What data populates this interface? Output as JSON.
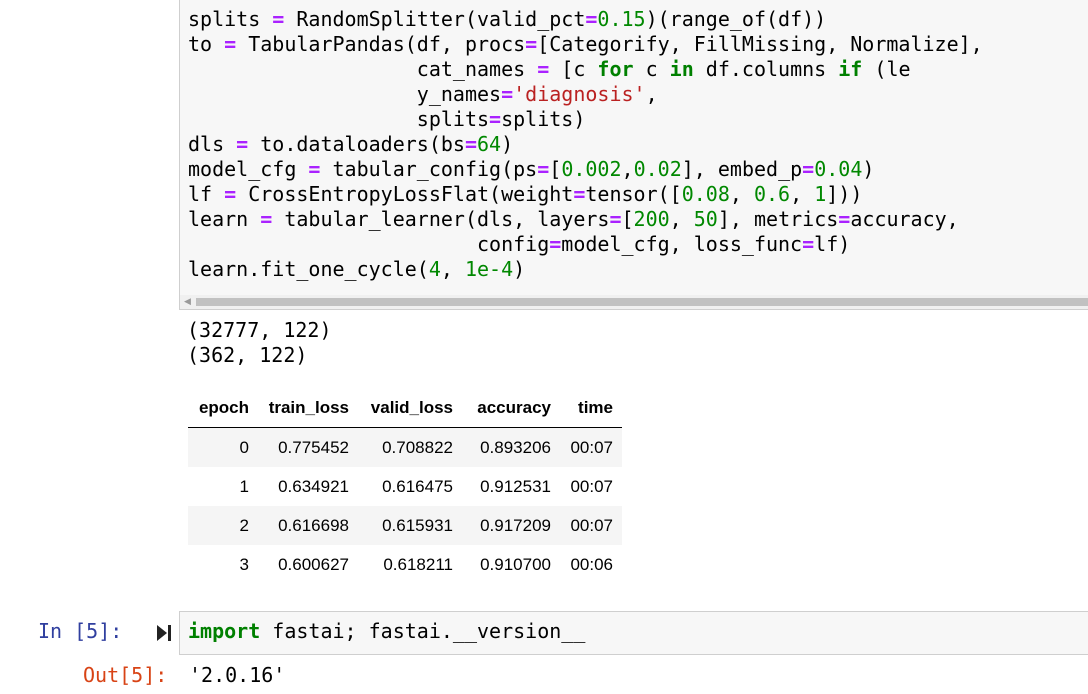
{
  "previous_cell": {
    "code_lines": [
      "splits = RandomSplitter(valid_pct=0.15)(range_of(df))",
      "to = TabularPandas(df, procs=[Categorify, FillMissing, Normalize],",
      "                   cat_names = [c for c in df.columns if (le",
      "                   y_names='diagnosis',",
      "                   splits=splits)",
      "dls = to.dataloaders(bs=64)",
      "model_cfg = tabular_config(ps=[0.002,0.02], embed_p=0.04)",
      "lf = CrossEntropyLossFlat(weight=tensor([0.08, 0.6, 1]))",
      "learn = tabular_learner(dls, layers=[200, 50], metrics=accuracy,",
      "                        config=model_cfg, loss_func=lf)",
      "learn.fit_one_cycle(4, 1e-4)"
    ],
    "stdout": [
      "(32777, 122)",
      "(362, 122)"
    ]
  },
  "results_table": {
    "columns": [
      "epoch",
      "train_loss",
      "valid_loss",
      "accuracy",
      "time"
    ],
    "rows": [
      [
        "0",
        "0.775452",
        "0.708822",
        "0.893206",
        "00:07"
      ],
      [
        "1",
        "0.634921",
        "0.616475",
        "0.912531",
        "00:07"
      ],
      [
        "2",
        "0.616698",
        "0.615931",
        "0.917209",
        "00:07"
      ],
      [
        "3",
        "0.600627",
        "0.618211",
        "0.910700",
        "00:06"
      ]
    ]
  },
  "current_cell": {
    "in_prompt": "In [5]:",
    "code": "import fastai; fastai.__version__",
    "out_prompt": "Out[5]:",
    "output": "'2.0.16'"
  },
  "icons": {
    "run": "run-cell-icon",
    "scroll": "scroll-left-arrow-icon"
  },
  "colors": {
    "in_prompt": "#303f9f",
    "out_prompt": "#d84315",
    "keyword": "#008000",
    "operator": "#aa22ff",
    "string": "#ba2121"
  }
}
